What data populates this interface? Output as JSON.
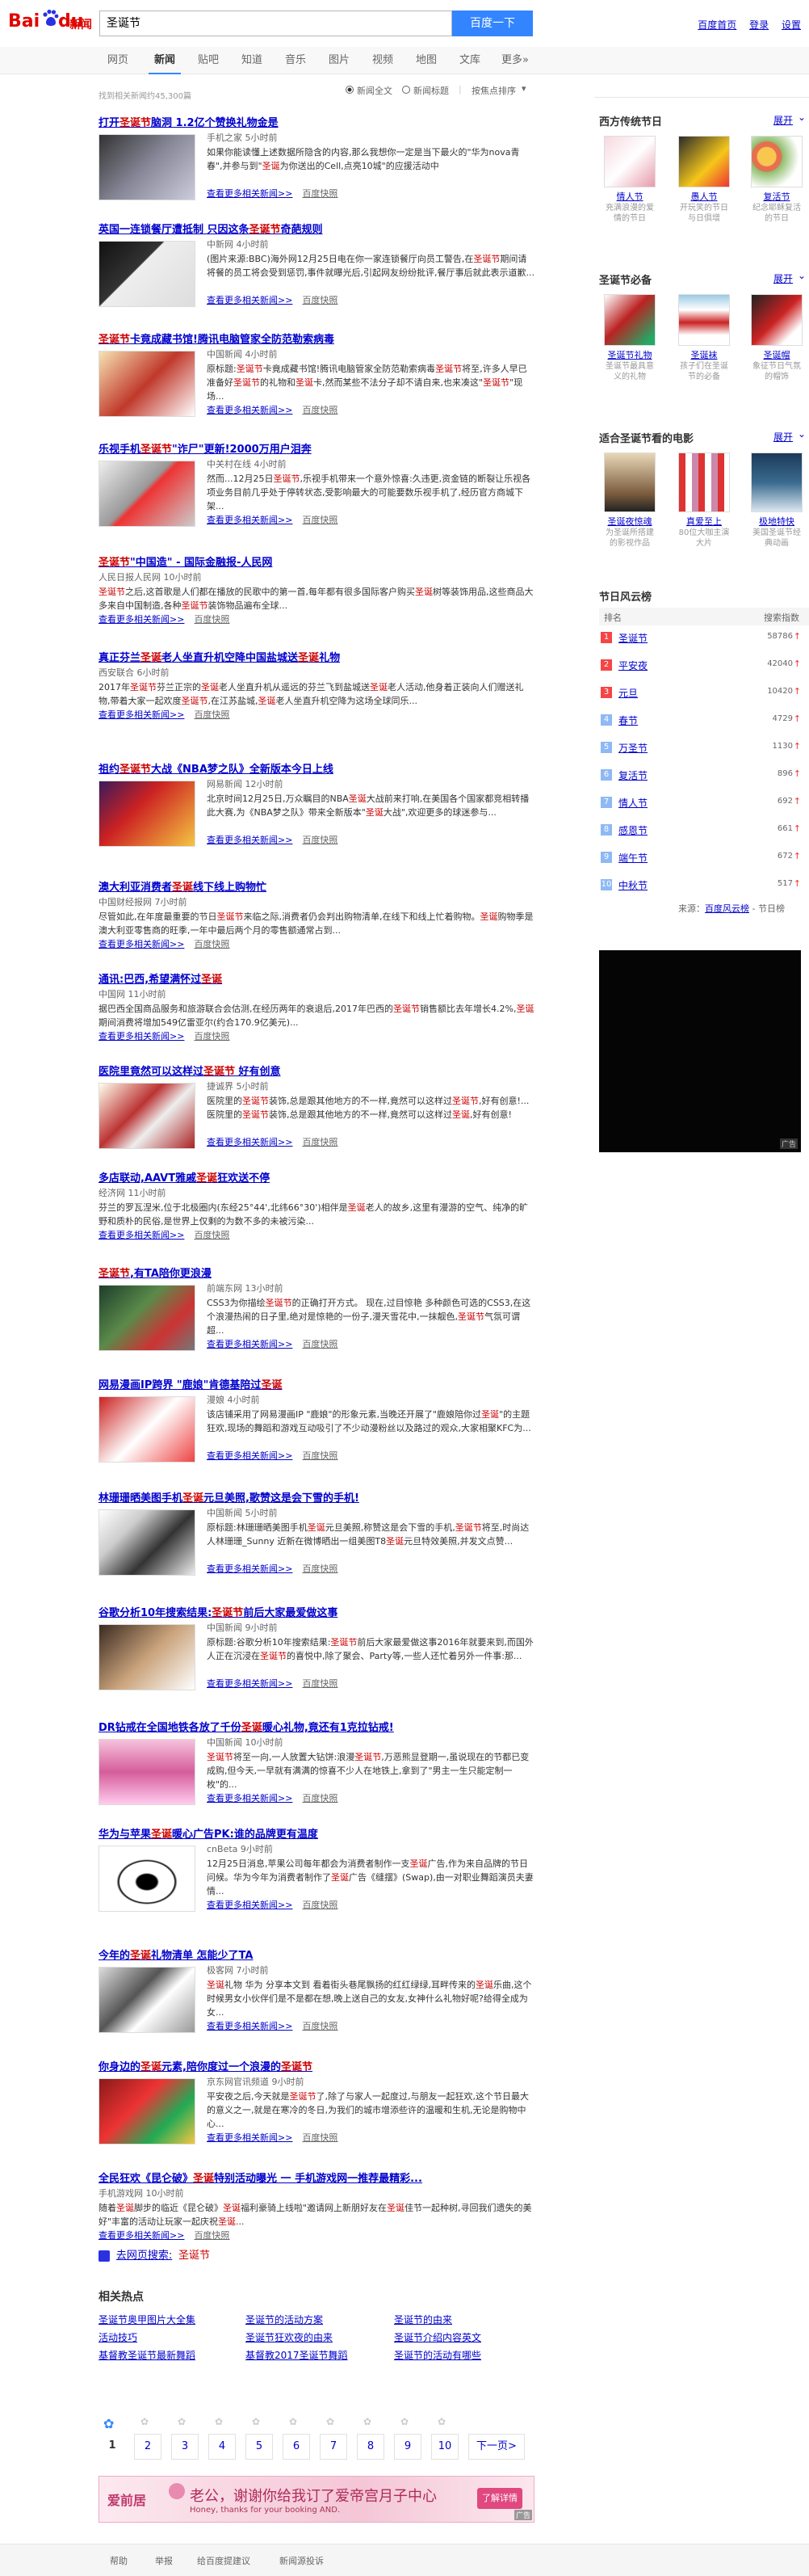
{
  "header": {
    "logo_text": "Bai",
    "logo_text2": "du",
    "logo_news": "新闻",
    "query": "圣诞节",
    "search_btn": "百度一下",
    "links": [
      "百度首页",
      "登录",
      "设置"
    ]
  },
  "nav": {
    "tabs": [
      "网页",
      "新闻",
      "贴吧",
      "知道",
      "音乐",
      "图片",
      "视频",
      "地图",
      "文库",
      "更多»"
    ]
  },
  "filters": {
    "opt1": "新闻全文",
    "opt2": "新闻标题",
    "sort": "按焦点排序"
  },
  "result_count": "找到相关新闻约45,300篇",
  "results": [
    {
      "title": "打开圣诞节脑洞 1.2亿个赞换礼物金是",
      "source": "手机之家  5小时前",
      "abstract": "如果你能读懂上述数据所隐含的内容,那么我想你一定是当下最火的\"华为nova青春\",并参与到\"圣诞为你送出的Cell,点亮10城\"的应援活动中",
      "more": "查看更多相关新闻>>",
      "cache": "百度快照"
    },
    {
      "title": "英国一连锁餐厅遭抵制 只因这条圣诞节奇葩规则",
      "source": "中新网  4小时前",
      "abstract": "(图片来源:BBC)海外网12月25日电在你一家连锁餐厅向员工警告,在圣诞节期间请将餐的员工将会受到惩罚,事件就曝光后,引起网友纷纷批评,餐厅事后就此表示道歉...",
      "more": "查看更多相关新闻>>",
      "cache": "百度快照"
    },
    {
      "title": "圣诞节卡竟成藏书馆!腾讯电脑管家全防范勒索病毒",
      "source": "中国新闻  4小时前",
      "abstract": "原标题:圣诞节卡竟成藏书馆!腾讯电脑管家全防范勒索病毒圣诞节将至,许多人早已准备好圣诞节的礼物和圣诞卡,然而某些不法分子却不请自来,也来凑这\"圣诞节\"现场...",
      "more": "查看更多相关新闻>>",
      "cache": "百度快照"
    },
    {
      "title": "乐视手机圣诞节\"诈尸\"更新!2000万用户泪奔",
      "source": "中关村在线  4小时前",
      "abstract": "然而...12月25日圣诞节,乐视手机带来一个意外惊喜:久违更,资金链的断裂让乐视各项业务目前几乎处于停转状态,受影响最大的可能要数乐视手机了,经历官方商城下架...",
      "more": "查看更多相关新闻>>",
      "cache": "百度快照"
    },
    {
      "title": "圣诞节\"中国造\" - 国际金融报-人民网",
      "source": "人民日报人民网  10小时前",
      "abstract": "圣诞节之后,这首歌是人们都在播放的民歌中的第一首,每年都有很多国际客户购买圣诞树等装饰用品,这些商品大多来自中国制造,各种圣诞节装饰物品遍布全球...",
      "more": "查看更多相关新闻>>",
      "cache": "百度快照"
    },
    {
      "title": "真正芬兰圣诞老人坐直升机空降中国盐城送圣诞礼物",
      "source": "西安联合  6小时前",
      "abstract": "2017年圣诞节芬兰正宗的圣诞老人坐直升机从遥远的芬兰飞到盐城送圣诞老人活动,他身着正装向人们赠送礼物,带着大家一起欢度圣诞节,在江苏盐城,圣诞老人坐直升机空降为这场全球同乐...",
      "more": "查看更多相关新闻>>",
      "cache": "百度快照"
    },
    {
      "title": "祖约圣诞节大战《NBA梦之队》全新版本今日上线",
      "source": "网易新闻  12小时前",
      "abstract": "北京时间12月25日,万众瞩目的NBA圣诞大战前来打响,在美国各个国家都竞相转播此大赛,为《NBA梦之队》带来全新版本\"圣诞大战\",欢迎更多的球迷参与...",
      "more": "查看更多相关新闻>>",
      "cache": "百度快照"
    },
    {
      "title": "澳大利亚消费者圣诞线下线上购物忙",
      "source": "中国财经报网  7小时前",
      "abstract": "尽管如此,在年度最重要的节日圣诞节来临之际,消费者仍会判出购物清单,在线下和线上忙着购物。圣诞购物季是澳大利亚零售商的旺季,一年中最后两个月的零售额通常占到...",
      "more": "查看更多相关新闻>>",
      "cache": "百度快照"
    },
    {
      "title": "通讯:巴西,希望满怀过圣诞",
      "source": "中国网  11小时前",
      "abstract": "据巴西全国商品服务和旅游联合会估测,在经历两年的衰退后,2017年巴西的圣诞节销售额比去年增长4.2%,圣诞期间消费将增加549亿雷亚尔(约合170.9亿美元)...",
      "more": "查看更多相关新闻>>",
      "cache": "百度快照"
    },
    {
      "title": "医院里竟然可以这样过圣诞节 好有创意",
      "source": "捷诚界  5小时前",
      "abstract": "医院里的圣诞节装饰,总是跟其他地方的不一样,竟然可以这样过圣诞节,好有创意!...医院里的圣诞节装饰,总是跟其他地方的不一样,竟然可以这样过圣诞,好有创意!",
      "more": "查看更多相关新闻>>",
      "cache": "百度快照"
    },
    {
      "title": "多店联动,AAVT雅戚圣诞狂欢送不停",
      "source": "经济网  11小时前",
      "abstract": "芬兰的罗瓦涅米,位于北极圈内(东经25°44',北纬66°30')相伴是圣诞老人的故乡,这里有漫游的空气、纯净的旷野和质朴的民俗,是世界上仅剩的为数不多的未被污染...",
      "more": "查看更多相关新闻>>",
      "cache": "百度快照"
    },
    {
      "title": "圣诞节,有TA陪你更浪漫",
      "source": "前端东网  13小时前",
      "abstract": "CSS3为你描绘圣诞节的正确打开方式。 现在,过目惊艳 多种颜色可选的CSS3,在这个浪漫热闹的日子里,绝对是惊艳的一份子,漫天雪花中,一抹靓色,圣诞节气氛可谓超...",
      "more": "查看更多相关新闻>>",
      "cache": "百度快照"
    },
    {
      "title": "网易漫画IP跨界 \"鹿娘\"肯德基陪过圣诞",
      "source": "漫娘  4小时前",
      "abstract": "该店铺采用了网易漫画IP \"鹿娘\"的形象元素,当晚还开展了\"鹿娘陪你过圣诞\"的主题狂欢,现场的舞蹈和游戏互动吸引了不少动漫粉丝以及路过的观众,大家相聚KFC为...",
      "more": "查看更多相关新闻>>",
      "cache": "百度快照"
    },
    {
      "title": "林珊珊晒美图手机圣诞元旦美照,歌赞这是会下雪的手机!",
      "source": "中国新闻  5小时前",
      "abstract": "原标题:林珊珊晒美图手机圣诞元旦美照,称赞这是会下雪的手机,圣诞节将至,时尚达人林珊珊_Sunny 近新在微博晒出一组美图T8圣诞元旦特效美照,并发文点赞...",
      "more": "查看更多相关新闻>>",
      "cache": "百度快照"
    },
    {
      "title": "谷歌分析10年搜索结果:圣诞节前后大家最爱做这事",
      "source": "中国新闻  9小时前",
      "abstract": "原标题:谷歌分析10年搜索结果:圣诞节前后大家最爱做这事2016年就要来到,而国外人正在沉浸在圣诞节的喜悦中,除了聚会、Party等,一些人还忙着另外一件事:那...",
      "more": "查看更多相关新闻>>",
      "cache": "百度快照"
    },
    {
      "title": "DR钻戒在全国地铁各放了千份圣诞暖心礼物,竟还有1克拉钻戒!",
      "source": "中国新闻  10小时前",
      "abstract": "圣诞节将至一向,一人放置大钻饼:浪漫圣诞节,万恶熊显登期一,虽说现在的节都已变成购,但今天,一早就有满满的惊喜不少人在地铁上,拿到了\"男主一生只能定制一枚\"的...",
      "more": "查看更多相关新闻>>",
      "cache": "百度快照"
    },
    {
      "title": "华为与苹果圣诞暖心广告PK:谁的品牌更有温度",
      "source": "cnBeta  9小时前",
      "abstract": "12月25日消息,苹果公司每年都会为消费者制作一支圣诞广告,作为来自品牌的节日问候。华为今年为消费者制作了圣诞广告《缝摆》(Swap),由一对职业舞蹈演员夫妻情...",
      "more": "查看更多相关新闻>>",
      "cache": "百度快照"
    },
    {
      "title": "今年的圣诞礼物清单 怎能少了TA",
      "source": "极客网  7小时前",
      "abstract": "圣诞礼物 华为 分享本文到 看着街头巷尾飘扬的红红绿绿,耳畔传来的圣诞乐曲,这个时候男女小伙伴们是不是都在想,晚上送自己的女友,女神什么礼物好呢?给得全成为女...",
      "more": "查看更多相关新闻>>",
      "cache": "百度快照"
    },
    {
      "title": "你身边的圣诞元素,陪你度过一个浪漫的圣诞节",
      "source": "京东网官讯频道  9小时前",
      "abstract": "平安夜之后,今天就是圣诞节了,除了与家人一起度过,与朋友一起狂欢,这个节日最大的意义之一,就是在寒冷的冬日,为我们的城市增添些许的温暖和生机,无论是购物中心...",
      "more": "查看更多相关新闻>>",
      "cache": "百度快照"
    },
    {
      "title": "全民狂欢《昆仑破》圣诞特别活动曝光 一 手机游戏网一推荐最精彩...",
      "source": "手机游戏网  10小时前",
      "abstract": "随着圣诞脚步的临近《昆仑破》圣诞福利豪骑上线啦\"邀请网上新朋好友在圣诞佳节一起种树,寻回我们遗失的美好\"丰富的活动让玩家一起庆祝圣诞...",
      "more": "查看更多相关新闻>>",
      "cache": "百度快照"
    }
  ],
  "search_more": {
    "prefix": "去网页搜索:",
    "kw": "圣诞节"
  },
  "related": {
    "title": "相关热点",
    "links": [
      "圣诞节奥甲图片大全集",
      "圣诞节的活动方案",
      "圣诞节的由来",
      "活动技巧",
      "圣诞节狂欢夜的由来",
      "圣诞节介绍内容英文",
      "基督教圣诞节最新舞蹈",
      "基督教2017圣诞节舞蹈",
      "圣诞节的活动有哪些"
    ]
  },
  "pagination": {
    "pages": [
      "1",
      "2",
      "3",
      "4",
      "5",
      "6",
      "7",
      "8",
      "9",
      "10"
    ],
    "next": "下一页>"
  },
  "ad": {
    "brand": "爱前居",
    "text": "老公，谢谢你给我订了爱帝宫月子中心",
    "sub": "Honey, thanks for your booking AND.",
    "cta": "了解详情",
    "tag": "广告"
  },
  "footer": {
    "links": [
      "帮助",
      "举报",
      "给百度提建议",
      "新闻源投诉"
    ]
  },
  "right": {
    "box1": {
      "title": "西方传统节日",
      "expand": "展开",
      "cards": [
        {
          "name": "情人节",
          "desc": "充满浪漫的爱情的节日"
        },
        {
          "name": "愚人节",
          "desc": "开玩笑的节日与日俱增"
        },
        {
          "name": "复活节",
          "desc": "纪念耶稣复活的节日"
        }
      ]
    },
    "box2": {
      "title": "圣诞节必备",
      "expand": "展开",
      "cards": [
        {
          "name": "圣诞节礼物",
          "desc": "圣诞节最具意义的礼物"
        },
        {
          "name": "圣诞袜",
          "desc": "孩子们在圣诞节的必备"
        },
        {
          "name": "圣诞帽",
          "desc": "象征节日气氛的帽饰"
        }
      ]
    },
    "box3": {
      "title": "适合圣诞节看的电影",
      "expand": "展开",
      "cards": [
        {
          "name": "圣诞夜惊魂",
          "desc": "为圣诞所搭建的影视作品"
        },
        {
          "name": "真爱至上",
          "desc": "80位大咖主演大片"
        },
        {
          "name": "极地特快",
          "desc": "美国圣诞节经典动画"
        }
      ]
    },
    "hot": {
      "title": "节日风云榜",
      "col1": "排名",
      "col2": "搜索指数",
      "items": [
        {
          "kw": "圣诞节",
          "v": "58786"
        },
        {
          "kw": "平安夜",
          "v": "42040"
        },
        {
          "kw": "元旦",
          "v": "10420"
        },
        {
          "kw": "春节",
          "v": "4729"
        },
        {
          "kw": "万圣节",
          "v": "1130"
        },
        {
          "kw": "复活节",
          "v": "896"
        },
        {
          "kw": "情人节",
          "v": "692"
        },
        {
          "kw": "感恩节",
          "v": "661"
        },
        {
          "kw": "端午节",
          "v": "672"
        },
        {
          "kw": "中秋节",
          "v": "517"
        }
      ],
      "source": "来源：",
      "source_link": "百度风云榜",
      "source_tail": " - 节日榜"
    },
    "ad_tag": "广告"
  },
  "colors": {
    "brand_red": "#e10601",
    "link": "#0000cc",
    "highlight": "#cc0000",
    "btn": "#3385ff"
  }
}
